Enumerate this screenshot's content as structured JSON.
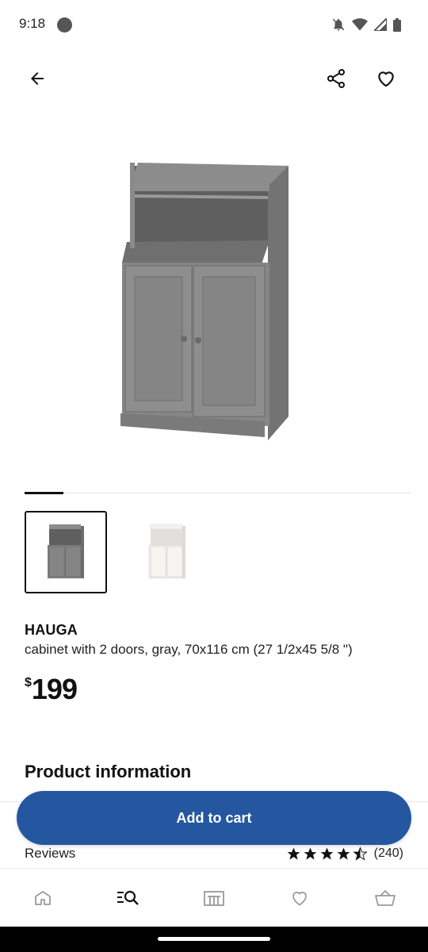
{
  "status_bar": {
    "time": "9:18"
  },
  "icons": {
    "back": "arrow-left-icon",
    "share": "share-icon",
    "favourite": "heart-icon",
    "home": "home-icon",
    "search": "search-list-icon",
    "store": "store-icon",
    "wishlist": "heart-icon",
    "cart": "basket-icon"
  },
  "product": {
    "name": "HAUGA",
    "description": "cabinet with 2 doors, gray, 70x116 cm (27 1/2x45 5/8 \")",
    "currency": "$",
    "price": "199",
    "variants": [
      {
        "color": "gray",
        "selected": true
      },
      {
        "color": "white",
        "selected": false
      }
    ]
  },
  "sections": {
    "product_information": "Product information"
  },
  "actions": {
    "add_to_cart": "Add to cart"
  },
  "reviews": {
    "label": "Reviews",
    "rating": 4.5,
    "max_rating": 5,
    "count": "(240)"
  },
  "colors": {
    "primary_button": "#2457a0",
    "cabinet_gray": "#7e7e7e",
    "cabinet_white": "#f0efec"
  }
}
